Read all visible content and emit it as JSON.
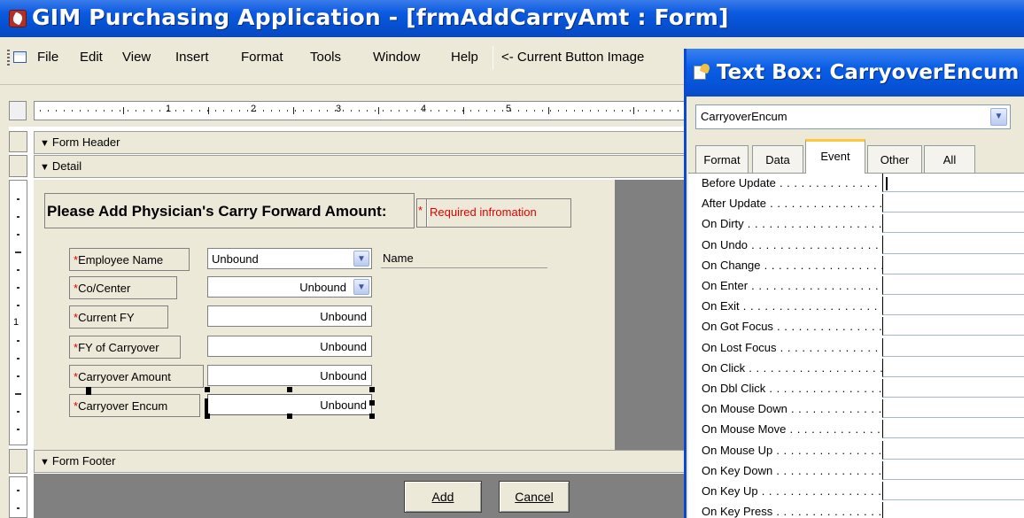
{
  "app": {
    "title": "GIM Purchasing Application - [frmAddCarryAmt : Form]"
  },
  "menu": {
    "items": [
      "File",
      "Edit",
      "View",
      "Insert",
      "Format",
      "Tools",
      "Window",
      "Help"
    ],
    "current_button_image": "<- Current Button Image"
  },
  "ruler": {
    "numbers": [
      "1",
      "2",
      "3",
      "4",
      "5"
    ],
    "vertical_number": "1"
  },
  "sections": {
    "header": "Form Header",
    "detail": "Detail",
    "footer": "Form Footer"
  },
  "form": {
    "heading": "Please Add Physician's Carry Forward Amount:",
    "required_star": "*",
    "required_note": "Required infromation",
    "fields": [
      {
        "label": "Employee Name",
        "value": "Unbound",
        "combo": true
      },
      {
        "label": "Co/Center",
        "value": "Unbound",
        "combo": true
      },
      {
        "label": "Current FY",
        "value": "Unbound",
        "combo": false
      },
      {
        "label": "FY of Carryover",
        "value": "Unbound",
        "combo": false
      },
      {
        "label": "Carryover Amount",
        "value": "Unbound",
        "combo": false
      },
      {
        "label": "Carryover Encum",
        "value": "Unbound",
        "combo": false,
        "selected": true
      }
    ],
    "name_label": "Name",
    "buttons": {
      "add": "Add",
      "cancel": "Cancel"
    }
  },
  "property_sheet": {
    "title": "Text Box: CarryoverEncum",
    "object_selector": "CarryoverEncum",
    "tabs": [
      "Format",
      "Data",
      "Event",
      "Other",
      "All"
    ],
    "active_tab": "Event",
    "properties": [
      "Before Update",
      "After Update",
      "On Dirty",
      "On Undo",
      "On Change",
      "On Enter",
      "On Exit",
      "On Got Focus",
      "On Lost Focus",
      "On Click",
      "On Dbl Click",
      "On Mouse Down",
      "On Mouse Move",
      "On Mouse Up",
      "On Key Down",
      "On Key Up",
      "On Key Press"
    ]
  },
  "colors": {
    "title_blue": "#0550d0",
    "required_red": "#e00000",
    "form_back": "#ece9d8",
    "dark_area": "#808080"
  }
}
